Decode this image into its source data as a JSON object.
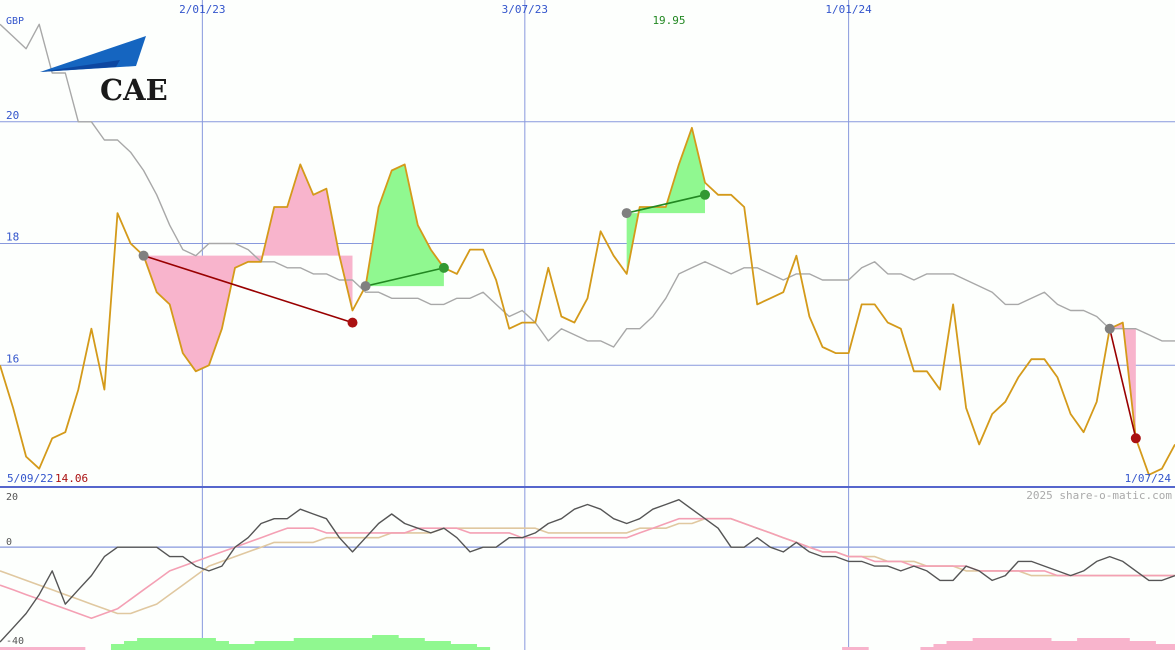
{
  "logo": {
    "text": "CAE"
  },
  "colors": {
    "background": "#fdfffd",
    "grid": "#8899dd",
    "axis_text": "#3355cc",
    "price": "#d49a1a",
    "moving_avg": "#a8a8a8",
    "up_fill": "#90f890",
    "down_fill": "#f8b4cc",
    "up_line": "#228822",
    "down_line": "#990000",
    "marker_gray": "#808080",
    "marker_green": "#339933",
    "marker_red": "#aa1111",
    "osc_dark": "#555555",
    "osc_pink": "#f4a0b4",
    "osc_tan": "#e0c8a0",
    "high_label": "#228822",
    "low_label": "#aa1111"
  },
  "chart_data": [
    {
      "type": "line",
      "panel": "price",
      "currency": "GBP",
      "y_ticks": [
        16,
        18,
        20
      ],
      "ylim": [
        14.0,
        22.0
      ],
      "x_ticks": [
        "2/01/23",
        "3/07/23",
        "1/01/24"
      ],
      "start_label": "5/09/22",
      "end_label": "1/07/24",
      "low_label": "14.06",
      "high_label": "19.95",
      "watermark": "2025 share-o-matic.com",
      "series": [
        {
          "role": "price",
          "values": [
            16.0,
            15.3,
            14.5,
            14.3,
            14.8,
            14.9,
            15.6,
            16.6,
            15.6,
            18.5,
            18.0,
            17.8,
            17.2,
            17.0,
            16.2,
            15.9,
            16.0,
            16.6,
            17.6,
            17.7,
            17.7,
            18.6,
            18.6,
            19.3,
            18.8,
            18.9,
            17.8,
            16.9,
            17.3,
            18.6,
            19.2,
            19.3,
            18.3,
            17.9,
            17.6,
            17.5,
            17.9,
            17.9,
            17.4,
            16.6,
            16.7,
            16.7,
            17.6,
            16.8,
            16.7,
            17.1,
            18.2,
            17.8,
            17.5,
            18.6,
            18.6,
            18.6,
            19.3,
            19.9,
            19.0,
            18.8,
            18.8,
            18.6,
            17.0,
            17.1,
            17.2,
            17.8,
            16.8,
            16.3,
            16.2,
            16.2,
            17.0,
            17.0,
            16.7,
            16.6,
            15.9,
            15.9,
            15.6,
            17.0,
            15.3,
            14.7,
            15.2,
            15.4,
            15.8,
            16.1,
            16.1,
            15.8,
            15.2,
            14.9,
            15.4,
            16.6,
            16.7,
            14.8,
            14.2,
            14.3,
            14.7
          ]
        },
        {
          "role": "moving_average",
          "values": [
            21.6,
            21.4,
            21.2,
            21.6,
            20.8,
            20.8,
            20.0,
            20.0,
            19.7,
            19.7,
            19.5,
            19.2,
            18.8,
            18.3,
            17.9,
            17.8,
            18.0,
            18.0,
            18.0,
            17.9,
            17.7,
            17.7,
            17.6,
            17.6,
            17.5,
            17.5,
            17.4,
            17.4,
            17.2,
            17.2,
            17.1,
            17.1,
            17.1,
            17.0,
            17.0,
            17.1,
            17.1,
            17.2,
            17.0,
            16.8,
            16.9,
            16.7,
            16.4,
            16.6,
            16.5,
            16.4,
            16.4,
            16.3,
            16.6,
            16.6,
            16.8,
            17.1,
            17.5,
            17.6,
            17.7,
            17.6,
            17.5,
            17.6,
            17.6,
            17.5,
            17.4,
            17.5,
            17.5,
            17.4,
            17.4,
            17.4,
            17.6,
            17.7,
            17.5,
            17.5,
            17.4,
            17.5,
            17.5,
            17.5,
            17.4,
            17.3,
            17.2,
            17.0,
            17.0,
            17.1,
            17.2,
            17.0,
            16.9,
            16.9,
            16.8,
            16.6,
            16.6,
            16.6,
            16.5,
            16.4,
            16.4
          ]
        }
      ],
      "signals": [
        {
          "direction": "down",
          "from": [
            11,
            17.8
          ],
          "to": [
            27,
            16.7
          ]
        },
        {
          "direction": "up",
          "from": [
            28,
            17.3
          ],
          "to": [
            34,
            17.6
          ]
        },
        {
          "direction": "up",
          "from": [
            48,
            18.5
          ],
          "to": [
            54,
            18.8
          ]
        },
        {
          "direction": "down",
          "from": [
            85,
            16.6
          ],
          "to": [
            87,
            14.8
          ]
        }
      ]
    },
    {
      "type": "line",
      "panel": "oscillator",
      "y_ticks": [
        20,
        0,
        -40
      ],
      "ylim": [
        -40,
        22
      ],
      "series": [
        {
          "role": "dark",
          "values": [
            -40,
            -34,
            -28,
            -20,
            -10,
            -24,
            -18,
            -12,
            -4,
            0,
            0,
            0,
            0,
            -4,
            -4,
            -8,
            -10,
            -8,
            0,
            4,
            10,
            12,
            12,
            16,
            14,
            12,
            4,
            -2,
            4,
            10,
            14,
            10,
            8,
            6,
            8,
            4,
            -2,
            0,
            0,
            4,
            4,
            6,
            10,
            12,
            16,
            18,
            16,
            12,
            10,
            12,
            16,
            18,
            20,
            16,
            12,
            8,
            0,
            0,
            4,
            0,
            -2,
            2,
            -2,
            -4,
            -4,
            -6,
            -6,
            -8,
            -8,
            -10,
            -8,
            -10,
            -14,
            -14,
            -8,
            -10,
            -14,
            -12,
            -6,
            -6,
            -8,
            -10,
            -12,
            -10,
            -6,
            -4,
            -6,
            -10,
            -14,
            -14,
            -12
          ]
        },
        {
          "role": "pink",
          "values": [
            -16,
            -18,
            -20,
            -22,
            -24,
            -26,
            -28,
            -30,
            -28,
            -26,
            -22,
            -18,
            -14,
            -10,
            -8,
            -6,
            -4,
            -2,
            0,
            2,
            4,
            6,
            8,
            8,
            8,
            6,
            6,
            6,
            6,
            6,
            6,
            6,
            8,
            8,
            8,
            8,
            6,
            6,
            6,
            6,
            4,
            4,
            4,
            4,
            4,
            4,
            4,
            4,
            4,
            6,
            8,
            10,
            12,
            12,
            12,
            12,
            12,
            10,
            8,
            6,
            4,
            2,
            0,
            -2,
            -2,
            -4,
            -4,
            -6,
            -6,
            -6,
            -8,
            -8,
            -8,
            -8,
            -8,
            -10,
            -10,
            -10,
            -10,
            -10,
            -10,
            -12,
            -12,
            -12,
            -12,
            -12,
            -12,
            -12,
            -12,
            -12,
            -12
          ]
        },
        {
          "role": "tan",
          "values": [
            -10,
            -12,
            -14,
            -16,
            -18,
            -20,
            -22,
            -24,
            -26,
            -28,
            -28,
            -26,
            -24,
            -20,
            -16,
            -12,
            -8,
            -6,
            -4,
            -2,
            0,
            2,
            2,
            2,
            2,
            4,
            4,
            4,
            4,
            4,
            6,
            6,
            6,
            6,
            8,
            8,
            8,
            8,
            8,
            8,
            8,
            8,
            6,
            6,
            6,
            6,
            6,
            6,
            6,
            8,
            8,
            8,
            10,
            10,
            12,
            12,
            12,
            10,
            8,
            6,
            4,
            2,
            0,
            -2,
            -2,
            -4,
            -4,
            -4,
            -6,
            -6,
            -6,
            -8,
            -8,
            -8,
            -10,
            -10,
            -10,
            -10,
            -10,
            -12,
            -12,
            -12,
            -12,
            -12,
            -12,
            -12,
            -12,
            -12,
            -12,
            -12,
            -12
          ]
        }
      ],
      "histogram": [
        -1,
        -1,
        -1,
        -1,
        -1,
        -1,
        -1,
        0,
        0,
        2,
        3,
        4,
        4,
        4,
        4,
        4,
        4,
        3,
        2,
        2,
        3,
        3,
        3,
        4,
        4,
        4,
        4,
        4,
        4,
        5,
        5,
        4,
        4,
        3,
        3,
        2,
        2,
        1,
        0,
        0,
        0,
        0,
        0,
        0,
        0,
        0,
        0,
        0,
        0,
        0,
        0,
        0,
        0,
        0,
        0,
        0,
        0,
        0,
        0,
        0,
        0,
        0,
        0,
        0,
        0,
        -1,
        -1,
        0,
        0,
        0,
        0,
        -1,
        -2,
        -3,
        -3,
        -4,
        -4,
        -4,
        -4,
        -4,
        -4,
        -3,
        -3,
        -4,
        -4,
        -4,
        -4,
        -3,
        -3,
        -2,
        -2
      ]
    }
  ]
}
